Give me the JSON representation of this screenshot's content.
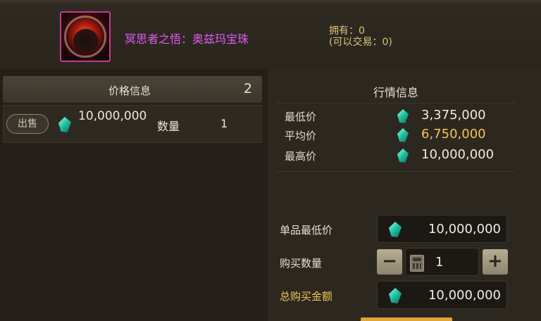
{
  "item": {
    "icon": "demon-orb-icon",
    "name": "冥思者之悟：奥兹玛宝珠",
    "owned": "拥有：0",
    "tradable": "(可以交易：0)"
  },
  "price_info": {
    "title": "价格信息",
    "count": "2",
    "listings": [
      {
        "action": "出售",
        "price": "10,000,000",
        "qty_label": "数量",
        "qty": "1"
      }
    ]
  },
  "market": {
    "title": "行情信息",
    "stats": [
      {
        "label": "最低价",
        "value": "3,375,000"
      },
      {
        "label": "平均价",
        "value": "6,750,000"
      },
      {
        "label": "最高价",
        "value": "10,000,000"
      }
    ]
  },
  "purchase": {
    "unit_price_label": "单品最低价",
    "unit_price": "10,000,000",
    "qty_label": "购买数量",
    "qty": "1",
    "total_label": "总购买金额",
    "total": "10,000,000"
  },
  "colors": {
    "item_name": "#e15af0",
    "gold_text": "#f2c55a",
    "currency_gem": "#22c7a5",
    "buy_button": "#e3a23a"
  }
}
